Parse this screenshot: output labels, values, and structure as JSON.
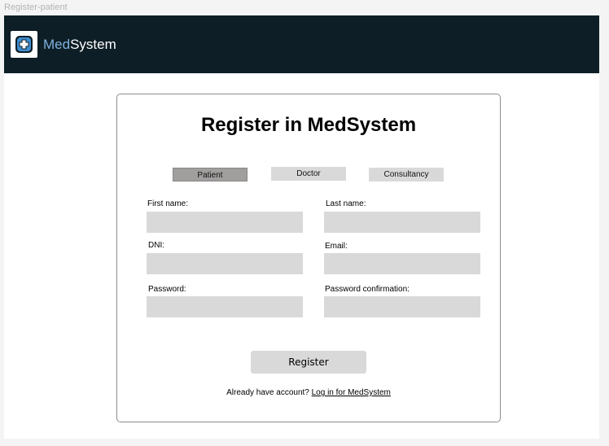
{
  "frame_label": "Register-patient",
  "header": {
    "brand_part1": "Med",
    "brand_part2": "System",
    "logo_icon": "medical-cross-icon",
    "background": "#0d1e26",
    "accent": "#7fb0de"
  },
  "form": {
    "title": "Register in MedSystem",
    "tabs": [
      {
        "label": "Patient",
        "active": true
      },
      {
        "label": "Doctor",
        "active": false
      },
      {
        "label": "Consultancy",
        "active": false
      }
    ],
    "fields": {
      "first_name": {
        "label": "First name:",
        "value": ""
      },
      "last_name": {
        "label": "Last name:",
        "value": ""
      },
      "dni": {
        "label": "DNI:",
        "value": ""
      },
      "email": {
        "label": "Email:",
        "value": ""
      },
      "password": {
        "label": "Password:",
        "value": ""
      },
      "password_confirmation": {
        "label": "Password confirmation:",
        "value": ""
      }
    },
    "register_label": "Register",
    "login_prompt": "Already have account?",
    "login_link": "Log in for MedSystem"
  }
}
